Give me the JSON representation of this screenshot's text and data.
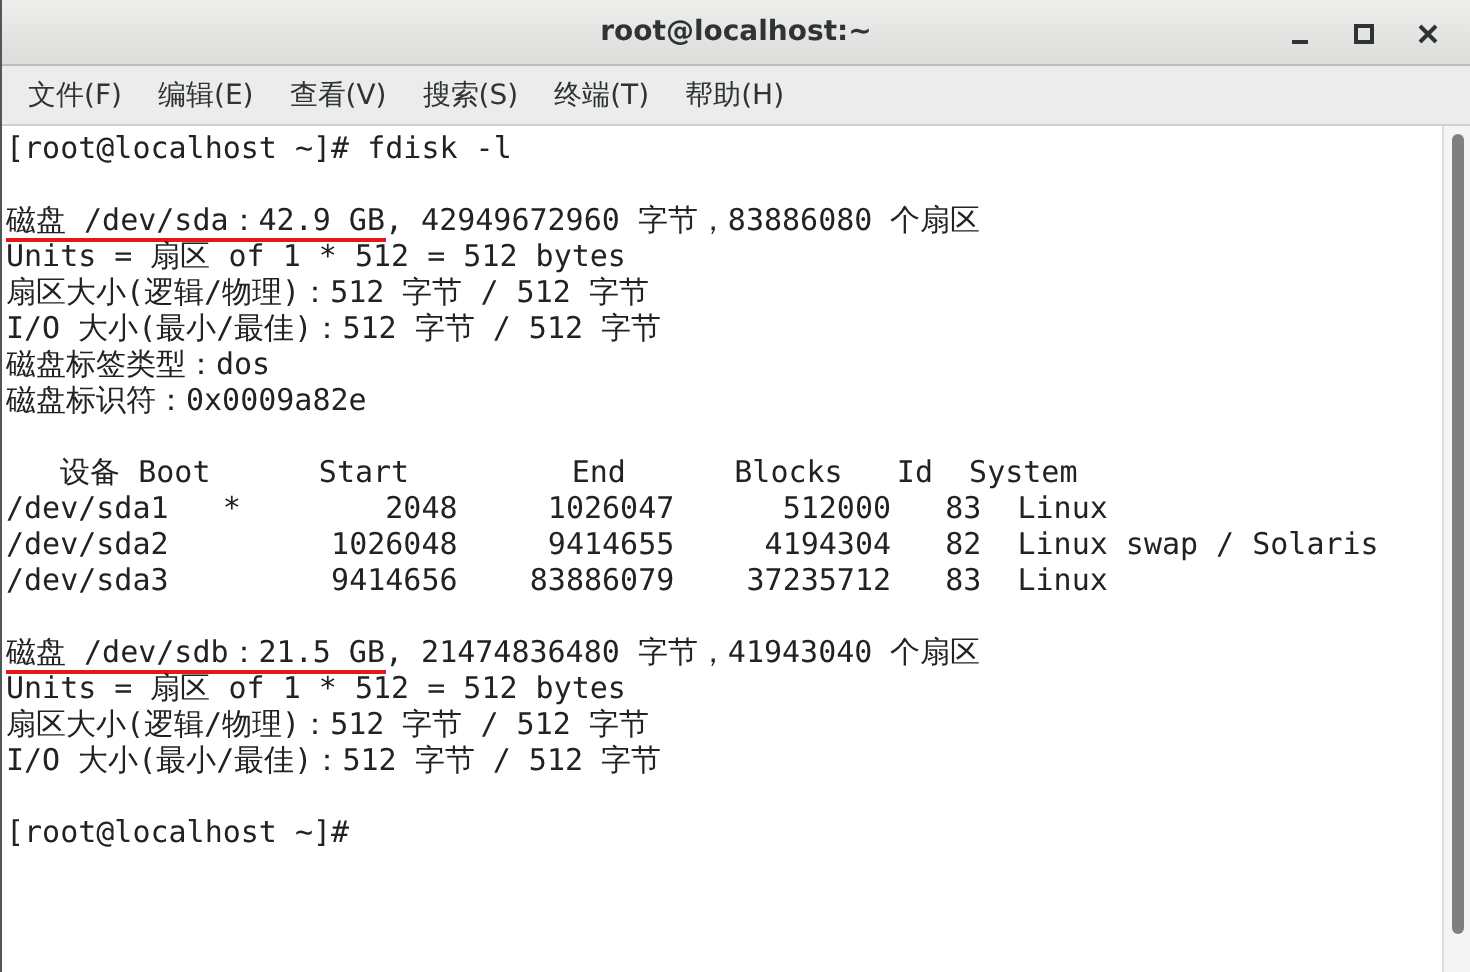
{
  "window": {
    "title": "root@localhost:~"
  },
  "menu": [
    "文件(F)",
    "编辑(E)",
    "查看(V)",
    "搜索(S)",
    "终端(T)",
    "帮助(H)"
  ],
  "terminal": {
    "lines": [
      {
        "kind": "plain",
        "text": "[root@localhost ~]# fdisk -l"
      },
      {
        "kind": "blank"
      },
      {
        "kind": "annotated",
        "marked": "磁盘 /dev/sda：42.9 GB",
        "rest": ", 42949672960 字节，83886080 个扇区"
      },
      {
        "kind": "plain",
        "text": "Units = 扇区 of 1 * 512 = 512 bytes"
      },
      {
        "kind": "plain",
        "text": "扇区大小(逻辑/物理)：512 字节 / 512 字节"
      },
      {
        "kind": "plain",
        "text": "I/O 大小(最小/最佳)：512 字节 / 512 字节"
      },
      {
        "kind": "plain",
        "text": "磁盘标签类型：dos"
      },
      {
        "kind": "plain",
        "text": "磁盘标识符：0x0009a82e"
      },
      {
        "kind": "blank"
      },
      {
        "kind": "plain",
        "text": "   设备 Boot      Start         End      Blocks   Id  System"
      },
      {
        "kind": "plain",
        "text": "/dev/sda1   *        2048     1026047      512000   83  Linux"
      },
      {
        "kind": "plain",
        "text": "/dev/sda2         1026048     9414655     4194304   82  Linux swap / Solaris"
      },
      {
        "kind": "plain",
        "text": "/dev/sda3         9414656    83886079    37235712   83  Linux"
      },
      {
        "kind": "blank"
      },
      {
        "kind": "annotated",
        "marked": "磁盘 /dev/sdb：21.5 GB",
        "rest": ", 21474836480 字节，41943040 个扇区"
      },
      {
        "kind": "plain",
        "text": "Units = 扇区 of 1 * 512 = 512 bytes"
      },
      {
        "kind": "plain",
        "text": "扇区大小(逻辑/物理)：512 字节 / 512 字节"
      },
      {
        "kind": "plain",
        "text": "I/O 大小(最小/最佳)：512 字节 / 512 字节"
      },
      {
        "kind": "blank"
      },
      {
        "kind": "plain",
        "text": "[root@localhost ~]#"
      }
    ]
  }
}
